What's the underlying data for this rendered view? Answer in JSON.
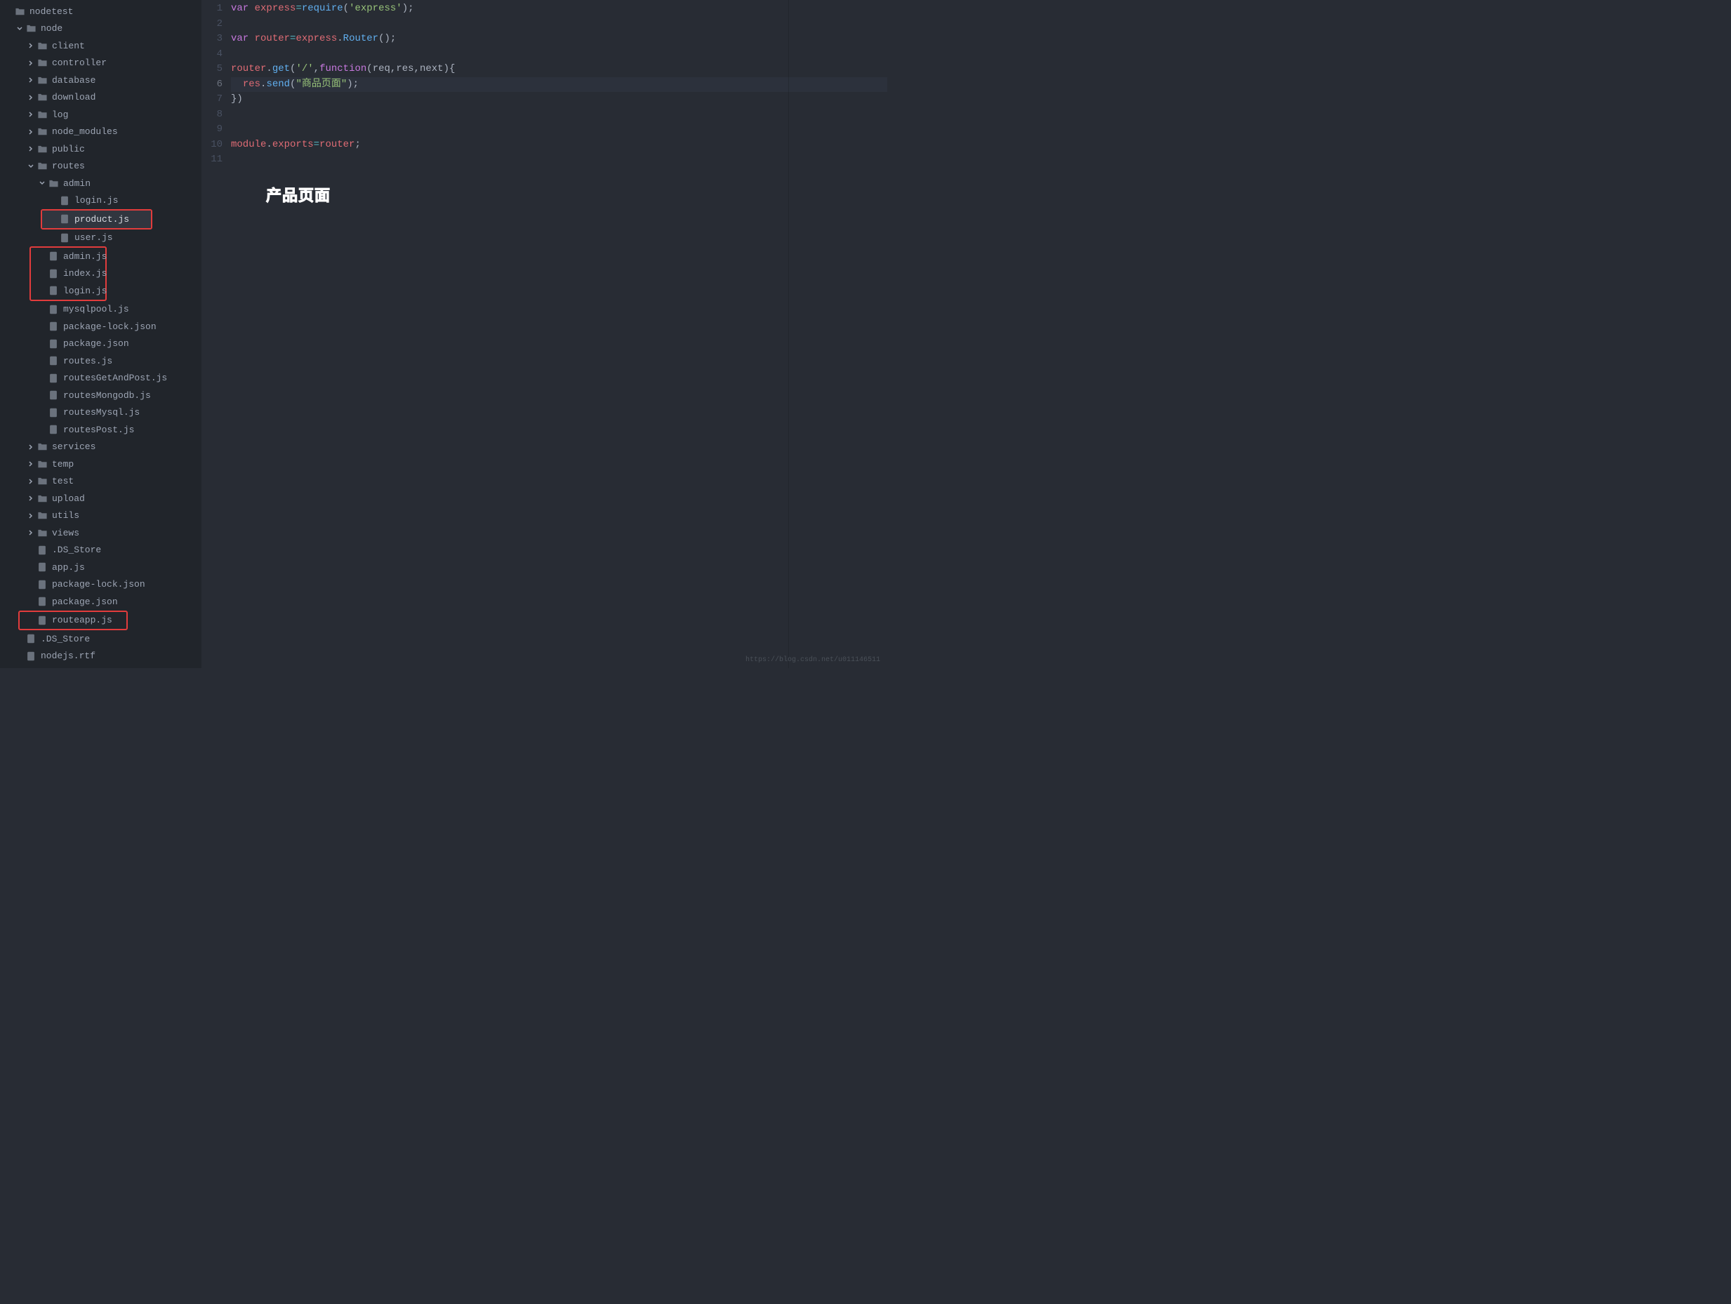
{
  "sidebar": {
    "root": "nodetest",
    "tree": [
      {
        "depth": 0,
        "type": "folder-open",
        "label": "nodetest",
        "chev": "none"
      },
      {
        "depth": 1,
        "type": "folder-open",
        "label": "node",
        "chev": "down"
      },
      {
        "depth": 2,
        "type": "folder",
        "label": "client",
        "chev": "right"
      },
      {
        "depth": 2,
        "type": "folder",
        "label": "controller",
        "chev": "right"
      },
      {
        "depth": 2,
        "type": "folder",
        "label": "database",
        "chev": "right"
      },
      {
        "depth": 2,
        "type": "folder",
        "label": "download",
        "chev": "right"
      },
      {
        "depth": 2,
        "type": "folder",
        "label": "log",
        "chev": "right"
      },
      {
        "depth": 2,
        "type": "folder",
        "label": "node_modules",
        "chev": "right"
      },
      {
        "depth": 2,
        "type": "folder",
        "label": "public",
        "chev": "right"
      },
      {
        "depth": 2,
        "type": "folder-open",
        "label": "routes",
        "chev": "down"
      },
      {
        "depth": 3,
        "type": "folder-open",
        "label": "admin",
        "chev": "down"
      },
      {
        "depth": 4,
        "type": "file",
        "label": "login.js",
        "chev": "none"
      },
      {
        "depth": 4,
        "type": "file",
        "label": "product.js",
        "chev": "none",
        "active": true,
        "red": "single"
      },
      {
        "depth": 4,
        "type": "file",
        "label": "user.js",
        "chev": "none"
      },
      {
        "depth": 3,
        "type": "file",
        "label": "admin.js",
        "chev": "none",
        "red": "top"
      },
      {
        "depth": 3,
        "type": "file",
        "label": "index.js",
        "chev": "none",
        "red": "mid"
      },
      {
        "depth": 3,
        "type": "file",
        "label": "login.js",
        "chev": "none",
        "red": "bot"
      },
      {
        "depth": 3,
        "type": "file",
        "label": "mysqlpool.js",
        "chev": "none"
      },
      {
        "depth": 3,
        "type": "file",
        "label": "package-lock.json",
        "chev": "none"
      },
      {
        "depth": 3,
        "type": "file",
        "label": "package.json",
        "chev": "none"
      },
      {
        "depth": 3,
        "type": "file",
        "label": "routes.js",
        "chev": "none"
      },
      {
        "depth": 3,
        "type": "file",
        "label": "routesGetAndPost.js",
        "chev": "none"
      },
      {
        "depth": 3,
        "type": "file",
        "label": "routesMongodb.js",
        "chev": "none"
      },
      {
        "depth": 3,
        "type": "file",
        "label": "routesMysql.js",
        "chev": "none"
      },
      {
        "depth": 3,
        "type": "file",
        "label": "routesPost.js",
        "chev": "none"
      },
      {
        "depth": 2,
        "type": "folder",
        "label": "services",
        "chev": "right"
      },
      {
        "depth": 2,
        "type": "folder",
        "label": "temp",
        "chev": "right"
      },
      {
        "depth": 2,
        "type": "folder",
        "label": "test",
        "chev": "right"
      },
      {
        "depth": 2,
        "type": "folder",
        "label": "upload",
        "chev": "right"
      },
      {
        "depth": 2,
        "type": "folder",
        "label": "utils",
        "chev": "right"
      },
      {
        "depth": 2,
        "type": "folder",
        "label": "views",
        "chev": "right"
      },
      {
        "depth": 2,
        "type": "file",
        "label": ".DS_Store",
        "chev": "none"
      },
      {
        "depth": 2,
        "type": "file",
        "label": "app.js",
        "chev": "none"
      },
      {
        "depth": 2,
        "type": "file",
        "label": "package-lock.json",
        "chev": "none"
      },
      {
        "depth": 2,
        "type": "file",
        "label": "package.json",
        "chev": "none"
      },
      {
        "depth": 2,
        "type": "file",
        "label": "routeapp.js",
        "chev": "none",
        "red": "single"
      },
      {
        "depth": 1,
        "type": "file",
        "label": ".DS_Store",
        "chev": "none"
      },
      {
        "depth": 1,
        "type": "file",
        "label": "nodejs.rtf",
        "chev": "none"
      }
    ]
  },
  "editor": {
    "lineNumbers": [
      "1",
      "2",
      "3",
      "4",
      "5",
      "6",
      "7",
      "8",
      "9",
      "10",
      "11"
    ],
    "currentLine": 6,
    "code": [
      [
        {
          "t": "kw",
          "v": "var"
        },
        {
          "t": "punc",
          "v": " "
        },
        {
          "t": "def",
          "v": "express"
        },
        {
          "t": "op",
          "v": "="
        },
        {
          "t": "fn",
          "v": "require"
        },
        {
          "t": "punc",
          "v": "("
        },
        {
          "t": "str",
          "v": "'express'"
        },
        {
          "t": "punc",
          "v": ");"
        }
      ],
      [],
      [
        {
          "t": "kw",
          "v": "var"
        },
        {
          "t": "punc",
          "v": " "
        },
        {
          "t": "def",
          "v": "router"
        },
        {
          "t": "op",
          "v": "="
        },
        {
          "t": "def",
          "v": "express"
        },
        {
          "t": "punc",
          "v": "."
        },
        {
          "t": "fn",
          "v": "Router"
        },
        {
          "t": "punc",
          "v": "();"
        }
      ],
      [],
      [
        {
          "t": "def",
          "v": "router"
        },
        {
          "t": "punc",
          "v": "."
        },
        {
          "t": "fn",
          "v": "get"
        },
        {
          "t": "punc",
          "v": "("
        },
        {
          "t": "str",
          "v": "'/'"
        },
        {
          "t": "punc",
          "v": ","
        },
        {
          "t": "kw",
          "v": "function"
        },
        {
          "t": "punc",
          "v": "("
        },
        {
          "t": "param",
          "v": "req"
        },
        {
          "t": "punc",
          "v": ","
        },
        {
          "t": "param",
          "v": "res"
        },
        {
          "t": "punc",
          "v": ","
        },
        {
          "t": "param",
          "v": "next"
        },
        {
          "t": "punc",
          "v": "){"
        }
      ],
      [
        {
          "t": "punc",
          "v": "  "
        },
        {
          "t": "def",
          "v": "res"
        },
        {
          "t": "punc",
          "v": "."
        },
        {
          "t": "fn",
          "v": "send"
        },
        {
          "t": "punc",
          "v": "("
        },
        {
          "t": "str",
          "v": "\"商品页面\""
        },
        {
          "t": "punc",
          "v": ");"
        }
      ],
      [
        {
          "t": "punc",
          "v": "})"
        }
      ],
      [],
      [],
      [
        {
          "t": "prop",
          "v": "module"
        },
        {
          "t": "punc",
          "v": "."
        },
        {
          "t": "prop",
          "v": "exports"
        },
        {
          "t": "op",
          "v": "="
        },
        {
          "t": "def",
          "v": "router"
        },
        {
          "t": "punc",
          "v": ";"
        }
      ],
      []
    ],
    "annotation": "产品页面"
  },
  "watermark": "https://blog.csdn.net/u011146511"
}
